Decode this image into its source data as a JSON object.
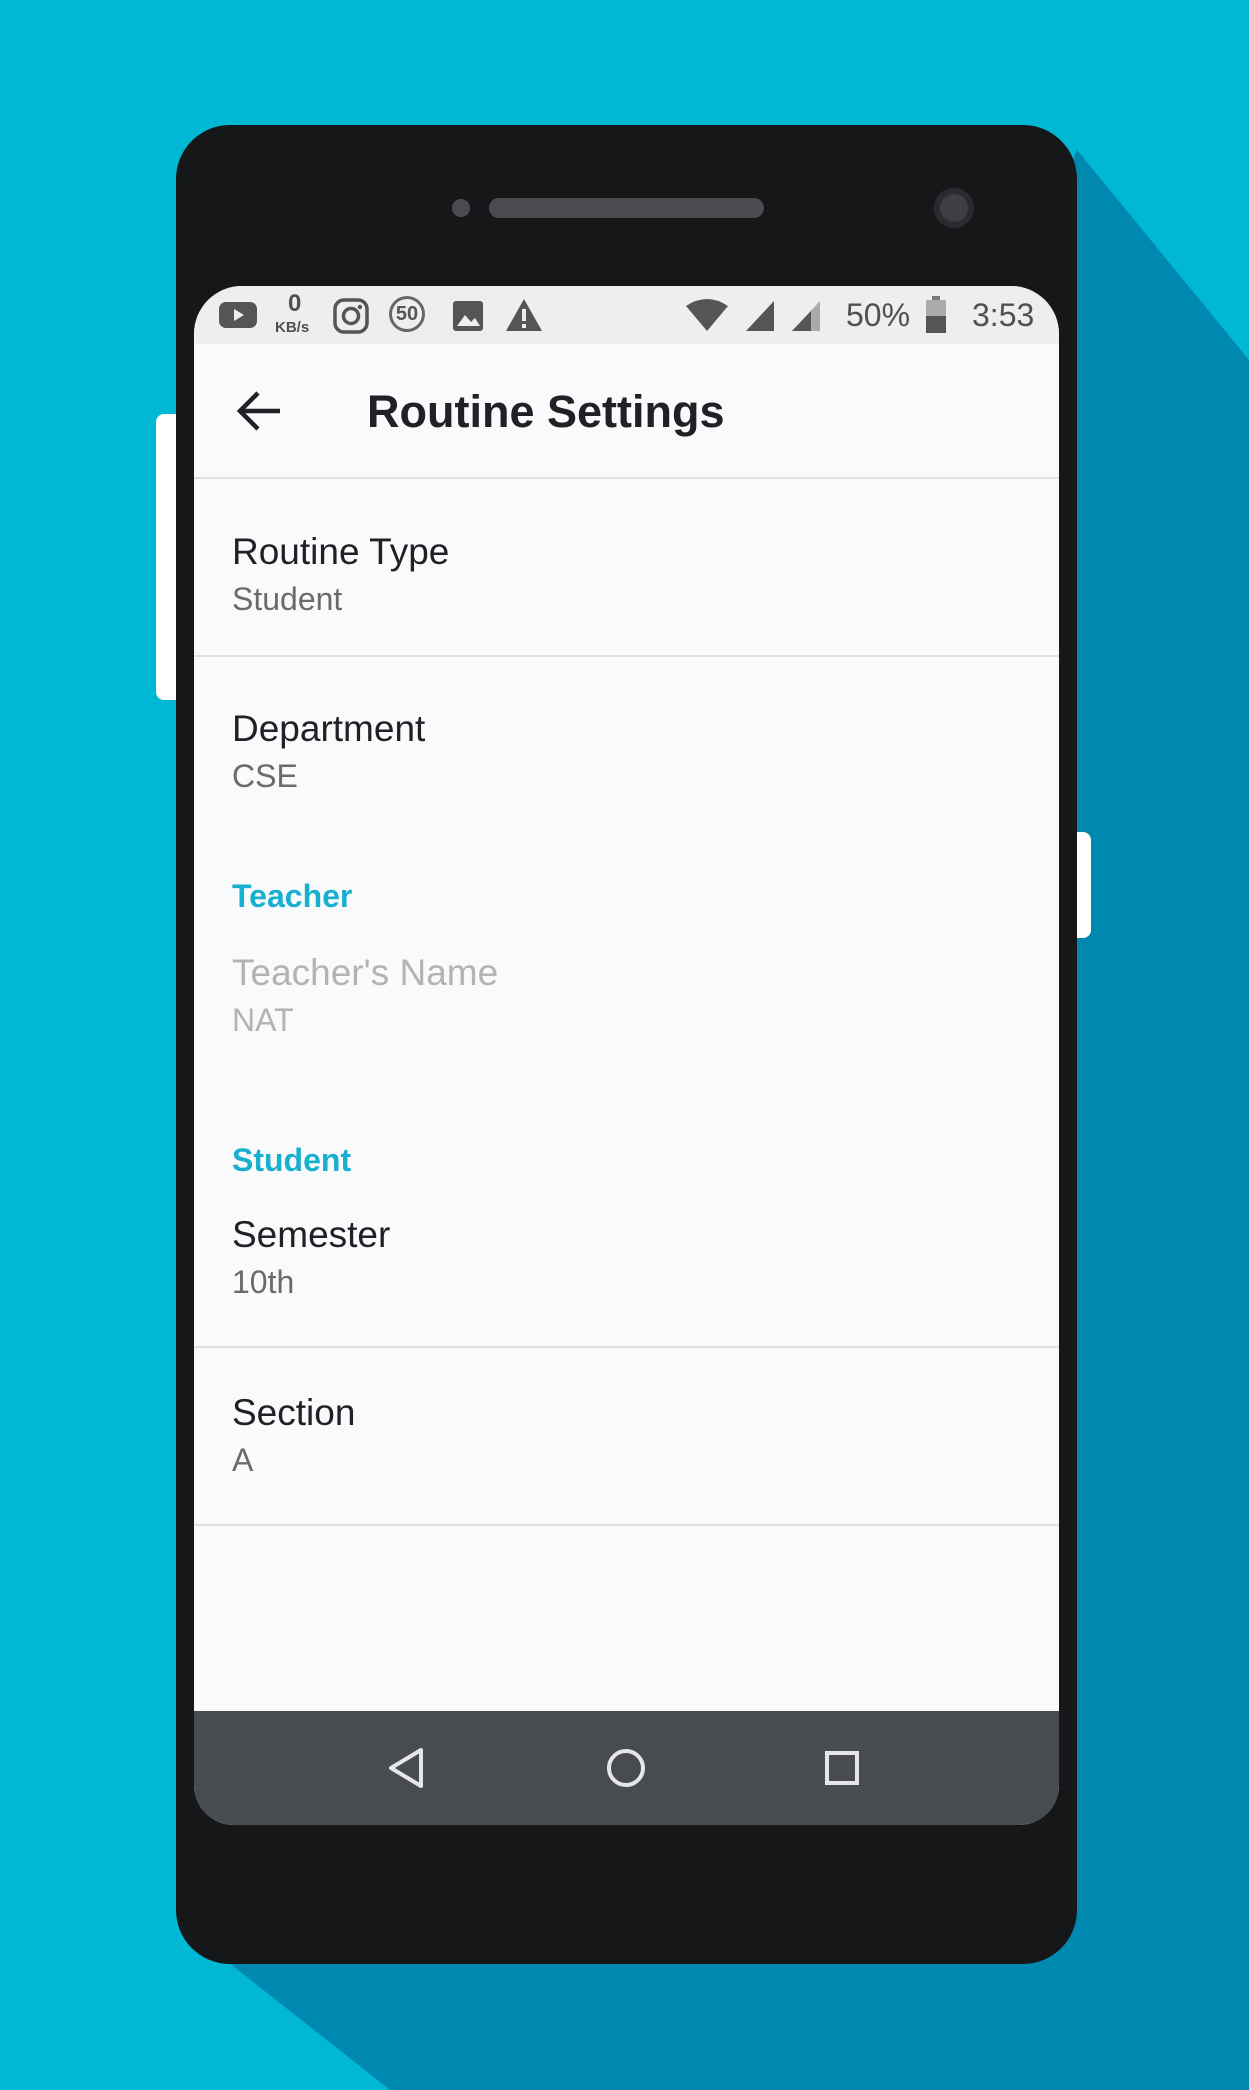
{
  "colors": {
    "background": "#00b7d4",
    "phone_body": "#161719",
    "screen_bg": "#f9fafc",
    "accent": "#17b0ce",
    "nav_bar": "#484b4f"
  },
  "status_bar": {
    "net_speed_value": "0",
    "net_speed_unit": "KB/s",
    "badge": "50",
    "battery": "50%",
    "time": "3:53",
    "icons": [
      "youtube-icon",
      "instagram-icon",
      "image-icon",
      "warning-icon",
      "wifi-icon",
      "signal-icon",
      "battery-icon"
    ]
  },
  "app_bar": {
    "title": "Routine Settings",
    "back_icon": "arrow-left-icon"
  },
  "preferences": {
    "routine_type": {
      "title": "Routine Type",
      "summary": "Student"
    },
    "department": {
      "title": "Department",
      "summary": "CSE"
    },
    "teacher_category": "Teacher",
    "teacher_name": {
      "title": "Teacher's Name",
      "summary": "NAT",
      "enabled": false
    },
    "student_category": "Student",
    "semester": {
      "title": "Semester",
      "summary": "10th"
    },
    "section": {
      "title": "Section",
      "summary": "A"
    }
  },
  "nav_bar": {
    "icons": [
      "back-triangle-icon",
      "home-circle-icon",
      "recents-square-icon"
    ]
  }
}
